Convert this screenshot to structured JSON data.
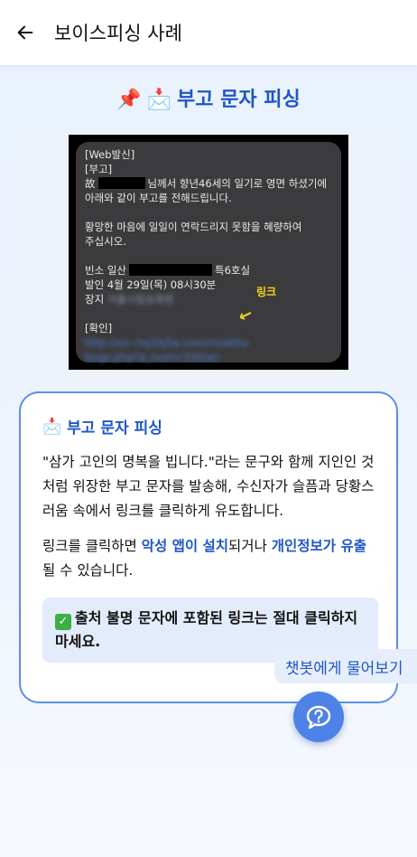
{
  "header": {
    "back_icon": "arrow-left-icon",
    "title": "보이스피싱 사례"
  },
  "section": {
    "pin_emoji": "📌",
    "envelope_emoji": "📩",
    "title": "부고 문자 피싱"
  },
  "sms": {
    "line1": "[Web발신]",
    "line2": "[부고]",
    "line3_prefix": "故",
    "line3_suffix": "님께서 향년46세의 일기로 영면 하셨기에",
    "line4": "아래와 같이 부고를 전해드립니다.",
    "line5": "황망한 마음에 일일이 연락드리지 못함을 혜량하여",
    "line6": "주십시오.",
    "line7_prefix": "빈소 일산",
    "line7_suffix": "특6호실",
    "line8": "발인 4월 29일(목) 08시30분",
    "line9_label": "장지",
    "line9_value": "서울시립승화원",
    "line10": "[확인]",
    "link1": "http://xn--hq1bj5a.com/m/obitu",
    "link2": "bugo.php?a_num=330(w)",
    "annotation": "링크",
    "arrow": "↙"
  },
  "card": {
    "title": "부고 문자 피싱",
    "text1": "\"삼가 고인의 명복을 빕니다.\"라는 문구와 함께 지인인 것처럼 위장한 부고 문자를 발송해, 수신자가 슬픔과 당황스러움 속에서 링크를 클릭하게 유도합니다.",
    "text2_a": "링크를 클릭하면 ",
    "text2_hl1": "악성 앱이 설치",
    "text2_b": "되거나 ",
    "text2_hl2": "개인정보가 유출",
    "text2_c": "될 수 있습니다.",
    "tip_check": "✓",
    "tip": "출처 불명 문자에 포함된 링크는 절대 클릭하지 마세요."
  },
  "chatbot": {
    "tooltip": "챗봇에게 물어보기",
    "icon": "help-chat-icon"
  },
  "colors": {
    "accent": "#1f56c7",
    "card_border": "#5b8fe8",
    "fab": "#4f82e6",
    "tip_bg": "#e3ecfb"
  }
}
